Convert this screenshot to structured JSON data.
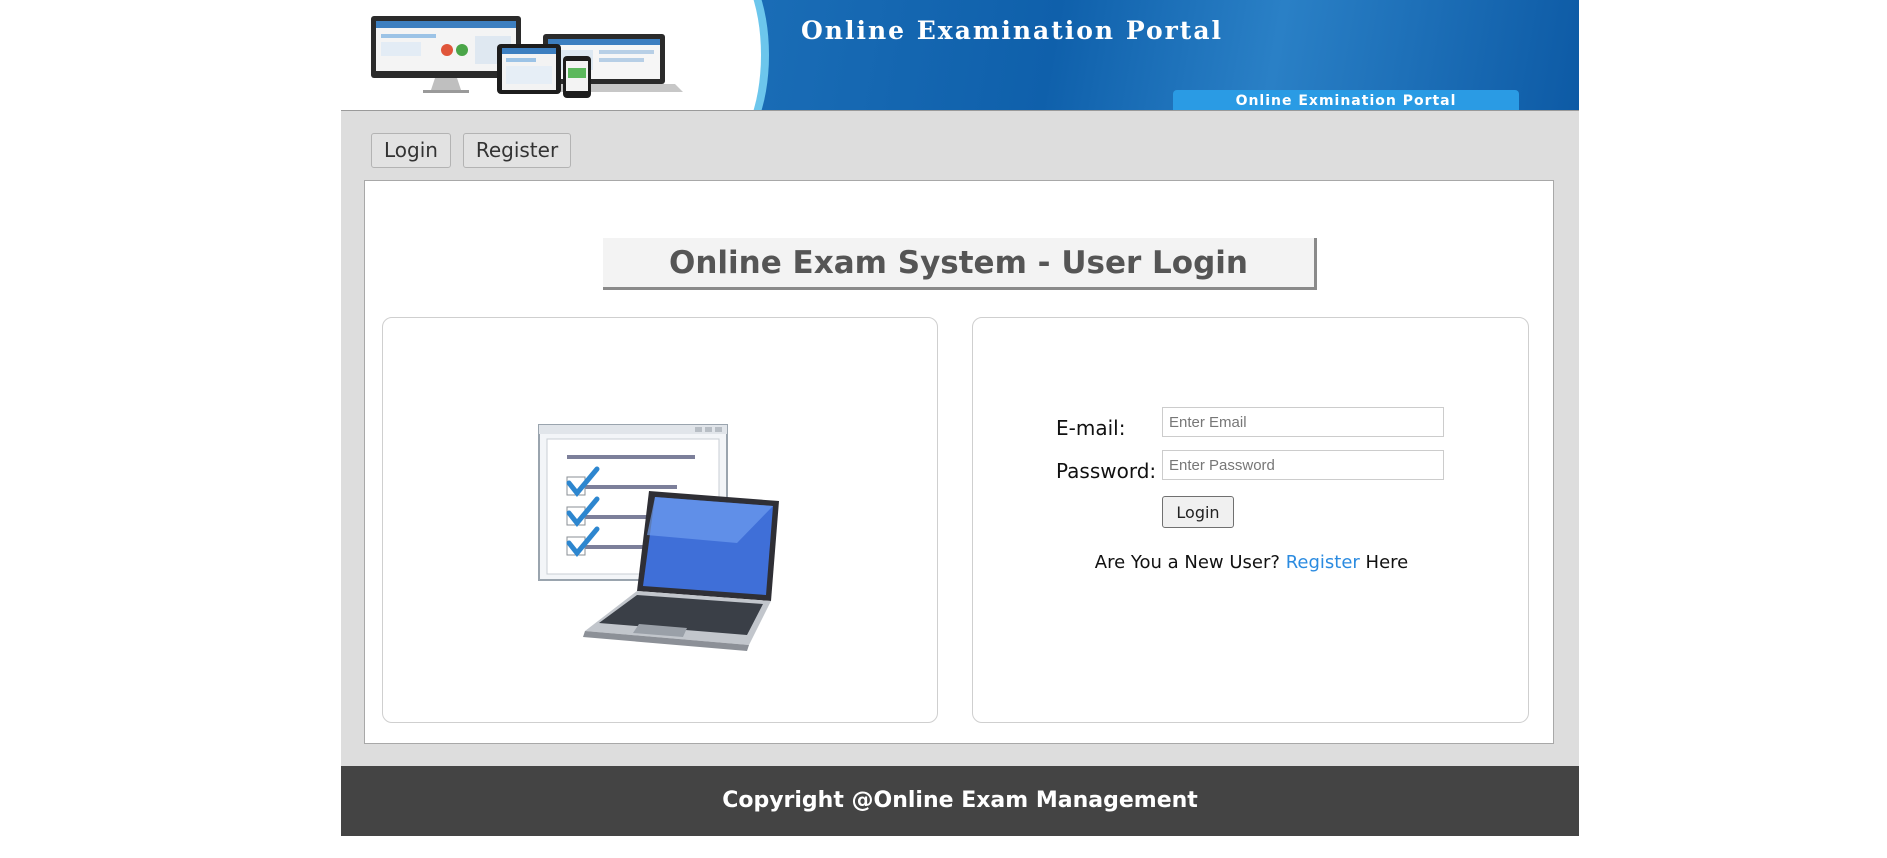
{
  "banner": {
    "title": "Online Examination Portal",
    "tab_label": "Online Exmination Portal",
    "icons": [
      "devices-illustration"
    ]
  },
  "nav": {
    "login_label": "Login",
    "register_label": "Register"
  },
  "main": {
    "heading": "Online Exam System - User Login",
    "illustration": "checklist-laptop-illustration",
    "form": {
      "email_label": "E-mail:",
      "email_placeholder": "Enter Email",
      "email_value": "",
      "password_label": "Password:",
      "password_placeholder": "Enter Password",
      "password_value": "",
      "submit_label": "Login",
      "new_user_prefix": "Are You a New User?",
      "register_link": "Register",
      "new_user_suffix": "Here"
    }
  },
  "footer": {
    "text": "Copyright @Online Exam Management"
  },
  "colors": {
    "banner_blue": "#1c6fb8",
    "link": "#2b8be0",
    "footer_bg": "#444444",
    "page_bg": "#dddddd"
  }
}
